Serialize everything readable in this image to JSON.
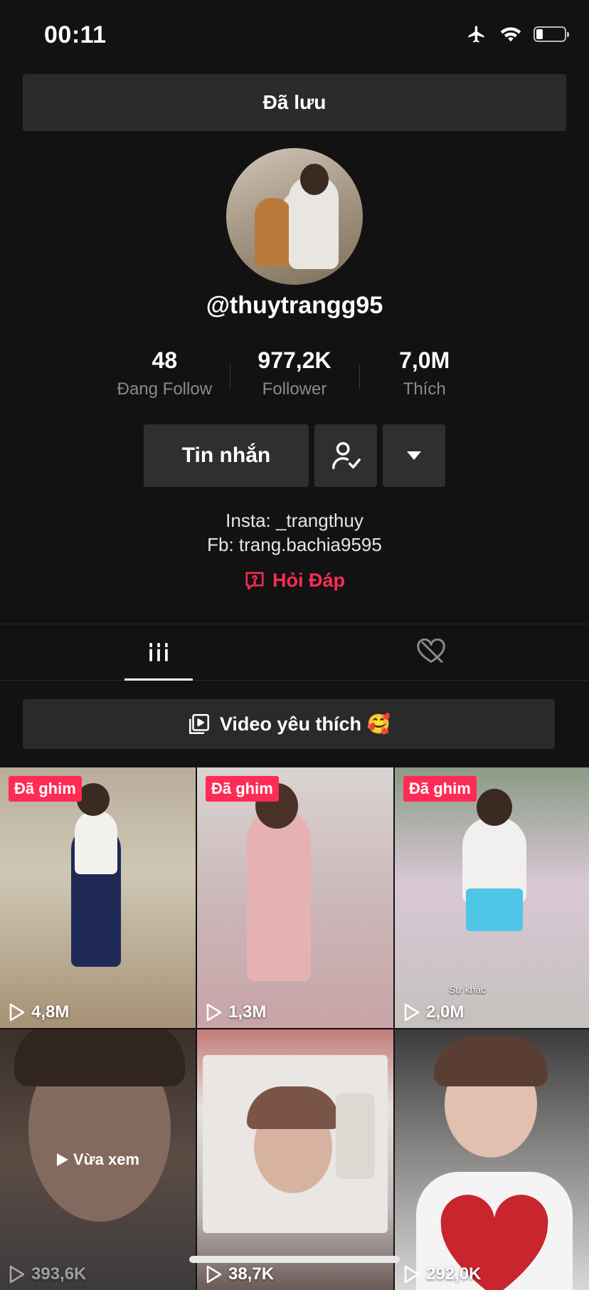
{
  "status_bar": {
    "time": "00:11"
  },
  "banner": {
    "label": "Đã lưu"
  },
  "profile": {
    "username": "@thuytrangg95",
    "stats": [
      {
        "value": "48",
        "label": "Đang Follow"
      },
      {
        "value": "977,2K",
        "label": "Follower"
      },
      {
        "value": "7,0M",
        "label": "Thích"
      }
    ],
    "message_button": "Tin nhắn",
    "bio_lines": [
      "Insta: _trangthuy",
      "Fb: trang.bachia9595"
    ],
    "qa_label": "Hỏi Đáp"
  },
  "favorite_banner": {
    "label": "Video yêu thích 🥰"
  },
  "videos": [
    {
      "pinned_label": "Đã ghim",
      "views": "4,8M"
    },
    {
      "pinned_label": "Đã ghim",
      "views": "1,3M"
    },
    {
      "pinned_label": "Đã ghim",
      "views": "2,0M",
      "caption": "Sự khác"
    },
    {
      "overlay": "Vừa xem",
      "views": "393,6K"
    },
    {
      "views": "38,7K"
    },
    {
      "views": "292,0K"
    }
  ],
  "colors": {
    "accent": "#fe2c55",
    "background": "#121212",
    "button": "#2f2f2f"
  }
}
